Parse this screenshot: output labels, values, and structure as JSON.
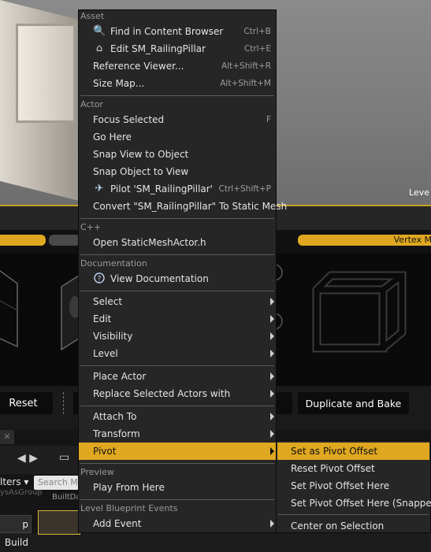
{
  "viewport": {
    "label": "Leve"
  },
  "lod_strip": {
    "right_label": "Vertex M"
  },
  "buttons": {
    "reset": "Reset",
    "duplicate_bake": "Duplicate and Bake"
  },
  "content_browser": {
    "filters": "lters ▾",
    "search_placeholder": "Search M",
    "group_label": "ysAsGroup",
    "build_label": "BuiltDa",
    "build_button": "p Build"
  },
  "menu": {
    "sections": {
      "asset": "Asset",
      "actor": "Actor",
      "cpp": "C++",
      "documentation": "Documentation",
      "preview": "Preview",
      "level_blueprint": "Level Blueprint Events"
    },
    "items": {
      "find_in_cb": {
        "label": "Find in Content Browser",
        "shortcut": "Ctrl+B",
        "icon": "magnifier-icon"
      },
      "edit_asset": {
        "label": "Edit SM_RailingPillar",
        "shortcut": "Ctrl+E",
        "icon": "home-icon"
      },
      "reference_viewer": {
        "label": "Reference Viewer...",
        "shortcut": "Alt+Shift+R"
      },
      "size_map": {
        "label": "Size Map...",
        "shortcut": "Alt+Shift+M"
      },
      "focus_selected": {
        "label": "Focus Selected",
        "shortcut": "F"
      },
      "go_here": {
        "label": "Go Here"
      },
      "snap_view": {
        "label": "Snap View to Object"
      },
      "snap_object": {
        "label": "Snap Object to View"
      },
      "pilot": {
        "label": "Pilot 'SM_RailingPillar'",
        "shortcut": "Ctrl+Shift+P",
        "icon": "airplane-icon"
      },
      "convert": {
        "label": "Convert \"SM_RailingPillar\" To Static Mesh"
      },
      "open_header": {
        "label": "Open StaticMeshActor.h"
      },
      "view_doc": {
        "label": "View Documentation",
        "icon": "help-icon"
      },
      "select": {
        "label": "Select"
      },
      "edit": {
        "label": "Edit"
      },
      "visibility": {
        "label": "Visibility"
      },
      "level": {
        "label": "Level"
      },
      "place_actor": {
        "label": "Place Actor"
      },
      "replace_actors": {
        "label": "Replace Selected Actors with"
      },
      "attach_to": {
        "label": "Attach To"
      },
      "transform": {
        "label": "Transform"
      },
      "pivot": {
        "label": "Pivot"
      },
      "play_from_here": {
        "label": "Play From Here"
      },
      "add_event": {
        "label": "Add Event"
      }
    }
  },
  "submenu": {
    "items": [
      "Set as Pivot Offset",
      "Reset Pivot Offset",
      "Set Pivot Offset Here",
      "Set Pivot Offset Here (Snapped)",
      "Center on Selection"
    ]
  },
  "colors": {
    "accent": "#e0a820",
    "menu_bg": "#262626"
  }
}
